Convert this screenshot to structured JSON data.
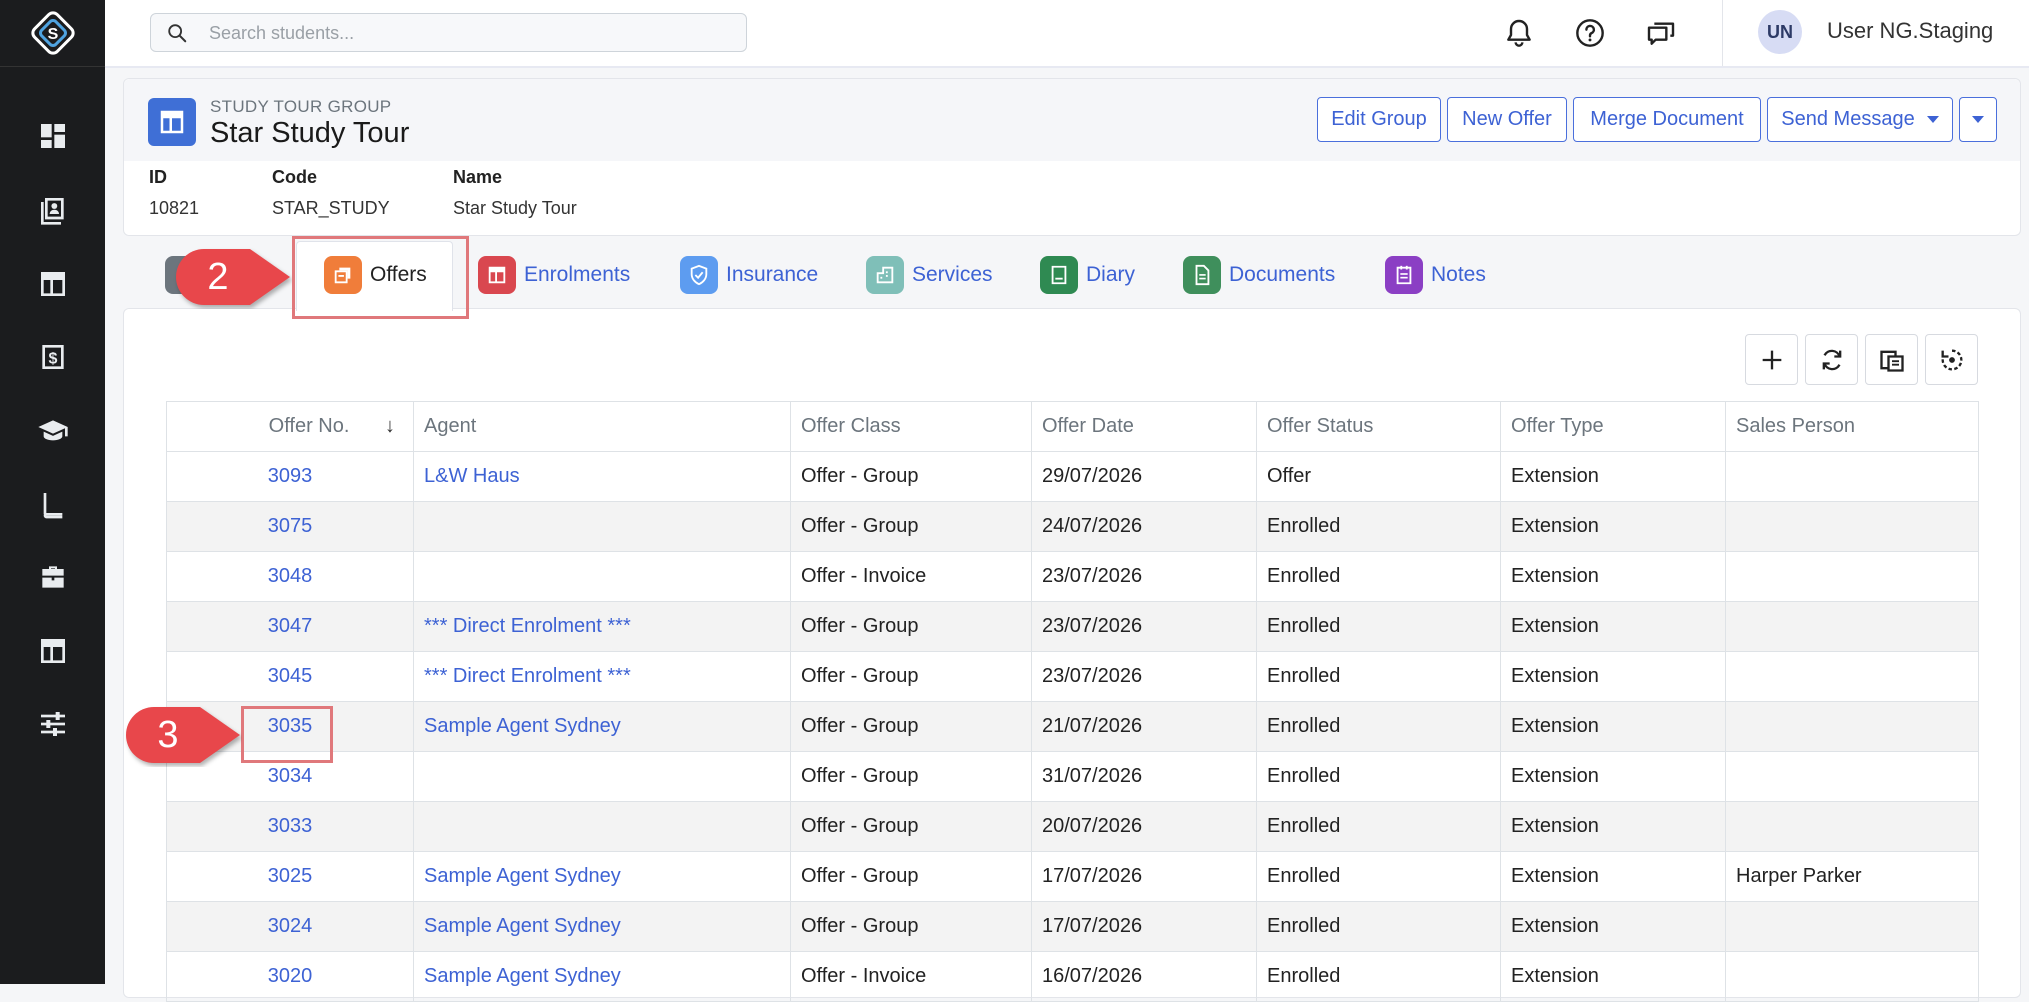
{
  "search": {
    "placeholder": "Search students..."
  },
  "user": {
    "initials": "UN",
    "name": "User NG.Staging"
  },
  "nav_icons": [
    "dashboard-icon",
    "students-icon",
    "layout-icon",
    "invoice-icon",
    "graduation-icon",
    "book-icon",
    "briefcase-icon",
    "layout-alt-icon",
    "settings-sliders-icon"
  ],
  "header": {
    "kicker": "STUDY TOUR GROUP",
    "title": "Star Study Tour",
    "buttons": {
      "edit_group": "Edit Group",
      "new_offer": "New Offer",
      "merge_document": "Merge Document",
      "send_message": "Send Message"
    },
    "meta": {
      "id_label": "ID",
      "id_value": "10821",
      "code_label": "Code",
      "code_value": "STAR_STUDY",
      "name_label": "Name",
      "name_value": "Star Study Tour"
    }
  },
  "tabs": [
    {
      "label": "Offers",
      "color": "#f07d3a",
      "icon": "offers-icon"
    },
    {
      "label": "Enrolments",
      "color": "#d9474f",
      "icon": "enrolments-icon"
    },
    {
      "label": "Insurance",
      "color": "#5d9cf0",
      "icon": "shield-icon"
    },
    {
      "label": "Services",
      "color": "#7fbfb8",
      "icon": "services-icon"
    },
    {
      "label": "Diary",
      "color": "#2f8a52",
      "icon": "diary-icon"
    },
    {
      "label": "Documents",
      "color": "#3f8f5c",
      "icon": "document-icon"
    },
    {
      "label": "Notes",
      "color": "#8b3fc4",
      "icon": "notes-icon"
    }
  ],
  "callouts": {
    "step2": "2",
    "step3": "3"
  },
  "table": {
    "columns": [
      "Offer No.",
      "Agent",
      "Offer Class",
      "Offer Date",
      "Offer Status",
      "Offer Type",
      "Sales Person"
    ],
    "sort_indicator": "↓",
    "rows": [
      [
        "3093",
        "L&W Haus",
        "Offer - Group",
        "29/07/2026",
        "Offer",
        "Extension",
        ""
      ],
      [
        "3075",
        "",
        "Offer - Group",
        "24/07/2026",
        "Enrolled",
        "Extension",
        ""
      ],
      [
        "3048",
        "",
        "Offer - Invoice",
        "23/07/2026",
        "Enrolled",
        "Extension",
        ""
      ],
      [
        "3047",
        "*** Direct Enrolment ***",
        "Offer - Group",
        "23/07/2026",
        "Enrolled",
        "Extension",
        ""
      ],
      [
        "3045",
        "*** Direct Enrolment ***",
        "Offer - Group",
        "23/07/2026",
        "Enrolled",
        "Extension",
        ""
      ],
      [
        "3035",
        "Sample Agent Sydney",
        "Offer - Group",
        "21/07/2026",
        "Enrolled",
        "Extension",
        ""
      ],
      [
        "3034",
        "",
        "Offer - Group",
        "31/07/2026",
        "Enrolled",
        "Extension",
        ""
      ],
      [
        "3033",
        "",
        "Offer - Group",
        "20/07/2026",
        "Enrolled",
        "Extension",
        ""
      ],
      [
        "3025",
        "Sample Agent Sydney",
        "Offer - Group",
        "17/07/2026",
        "Enrolled",
        "Extension",
        "Harper Parker"
      ],
      [
        "3024",
        "Sample Agent Sydney",
        "Offer - Group",
        "17/07/2026",
        "Enrolled",
        "Extension",
        ""
      ],
      [
        "3020",
        "Sample Agent Sydney",
        "Offer - Invoice",
        "16/07/2026",
        "Enrolled",
        "Extension",
        ""
      ]
    ]
  }
}
